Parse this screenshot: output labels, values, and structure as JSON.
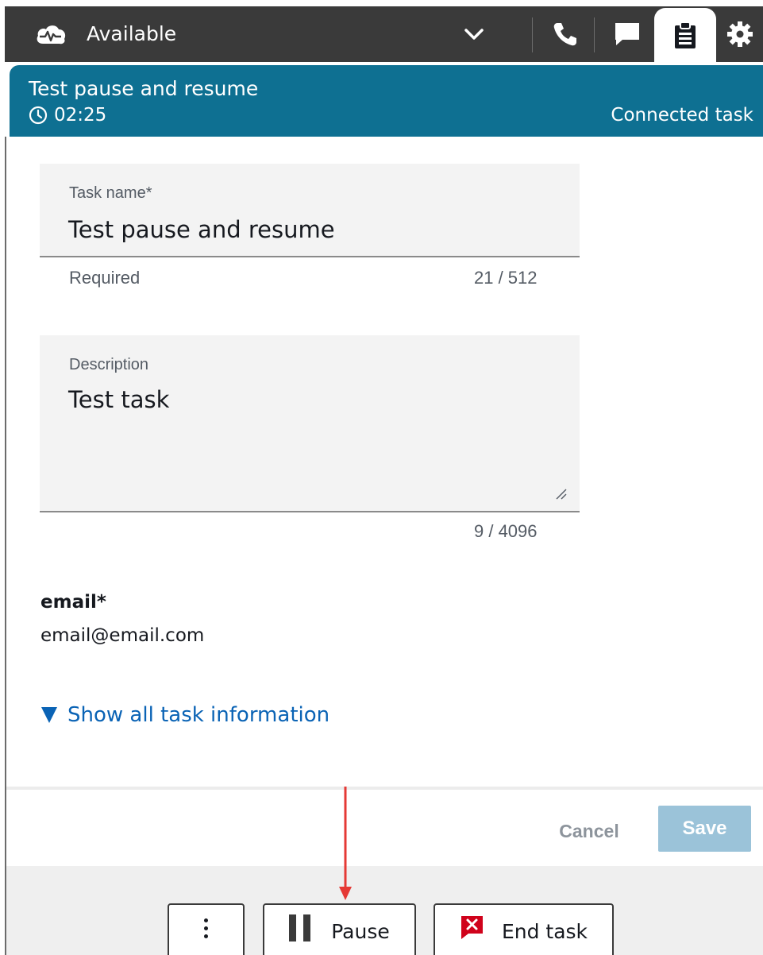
{
  "topbar": {
    "status_label": "Available",
    "icons": [
      "cloud-heartbeat-icon",
      "chevron-down-icon",
      "phone-icon",
      "chat-icon",
      "clipboard-icon",
      "gear-icon"
    ]
  },
  "contact": {
    "title": "Test pause and resume",
    "timer": "02:25",
    "type": "Connected task",
    "color": "#0e7092"
  },
  "form": {
    "task_name": {
      "label": "Task name*",
      "value": "Test pause and resume",
      "helper": "Required",
      "count": "21 / 512"
    },
    "description": {
      "label": "Description",
      "value": "Test task",
      "count": "9 / 4096"
    }
  },
  "attributes": {
    "email_label": "email*",
    "email_value": "email@email.com"
  },
  "show_all_label": "Show all task information",
  "footer": {
    "cancel_label": "Cancel",
    "save_label": "Save"
  },
  "actions": {
    "pause_label": "Pause",
    "end_label": "End task"
  },
  "colors": {
    "accent": "#0e7092",
    "link": "#0a63b5",
    "save_disabled": "#9bc3d9",
    "end_icon": "#d0021b",
    "annotation_arrow": "#e53935"
  }
}
